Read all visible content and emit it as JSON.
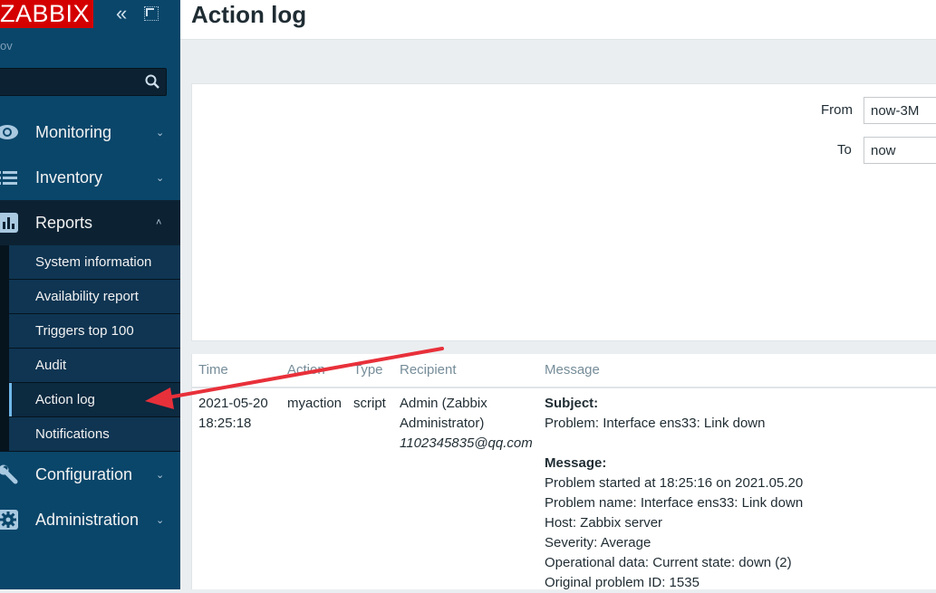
{
  "sidebar": {
    "logo": "ZABBIX",
    "collapse_icon": "«",
    "server_name": "ov",
    "search": {
      "placeholder": "",
      "value": ""
    },
    "menu": [
      {
        "label": "Monitoring",
        "icon": "eye-icon",
        "chevron": "⌄"
      },
      {
        "label": "Inventory",
        "icon": "list-icon",
        "chevron": "⌄"
      },
      {
        "label": "Reports",
        "icon": "bar-chart-icon",
        "chevron": "˄"
      },
      {
        "label": "Configuration",
        "icon": "wrench-icon",
        "chevron": "⌄"
      },
      {
        "label": "Administration",
        "icon": "gear-icon",
        "chevron": "⌄"
      }
    ],
    "reports_submenu": [
      {
        "label": "System information"
      },
      {
        "label": "Availability report"
      },
      {
        "label": "Triggers top 100"
      },
      {
        "label": "Audit"
      },
      {
        "label": "Action log",
        "active": true
      },
      {
        "label": "Notifications"
      }
    ]
  },
  "header": {
    "title": "Action log"
  },
  "filter": {
    "from_label": "From",
    "from_value": "now-3M",
    "to_label": "To",
    "to_value": "now"
  },
  "table": {
    "columns": [
      "Time",
      "Action",
      "Type",
      "Recipient",
      "Message"
    ],
    "rows": [
      {
        "time_date": "2021-05-20",
        "time_clock": "18:25:18",
        "action": "myaction",
        "type": "script",
        "recipient_name_1": "Admin (Zabbix",
        "recipient_name_2": "Administrator)",
        "recipient_email": "1102345835@qq.com",
        "subject_label": "Subject:",
        "subject": "Problem: Interface ens33: Link down",
        "message_label": "Message:",
        "message_lines": [
          "Problem started at 18:25:16 on 2021.05.20",
          "Problem name: Interface ens33: Link down",
          "Host: Zabbix server",
          "Severity: Average",
          "Operational data: Current state: down (2)",
          "Original problem ID: 1535"
        ]
      }
    ]
  },
  "annotation": {
    "arrow_color": "#e8303a"
  }
}
